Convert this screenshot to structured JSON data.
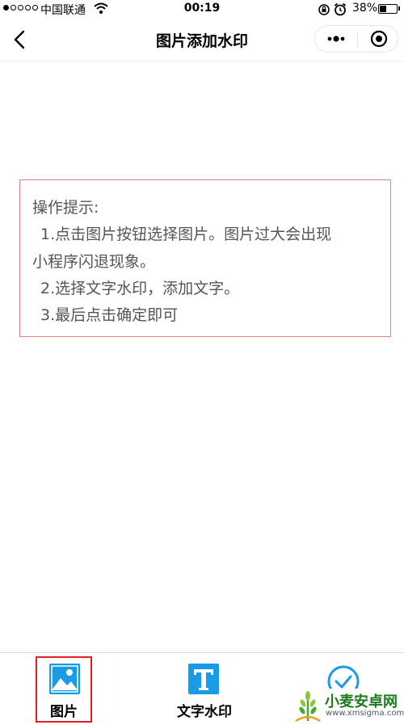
{
  "status_bar": {
    "carrier": "中国联通",
    "time": "00:19",
    "battery": "38%",
    "battery_level": 0.38,
    "signal_filled": 1,
    "signal_total": 5
  },
  "nav": {
    "title": "图片添加水印",
    "back_icon": "chevron-left-icon",
    "more_icon": "more-dots-icon",
    "close_icon": "target-circle-icon"
  },
  "tips": {
    "title": "操作提示:",
    "line1": "1.点击图片按钮选择图片。图片过大会出现",
    "line1_cont": "小程序闪退现象。",
    "line2": "2.选择文字水印，添加文字。",
    "line3": "3.最后点击确定即可"
  },
  "toolbar": {
    "picture_label": "图片",
    "text_watermark_label": "文字水印",
    "picture_icon": "image-icon",
    "text_icon": "text-t-icon",
    "confirm_icon": "check-circle-icon",
    "accent_color": "#1a9be6",
    "highlight_color": "#e02020"
  },
  "watermark": {
    "title": "小麦安卓网",
    "url": "www.xmsigma.com"
  }
}
